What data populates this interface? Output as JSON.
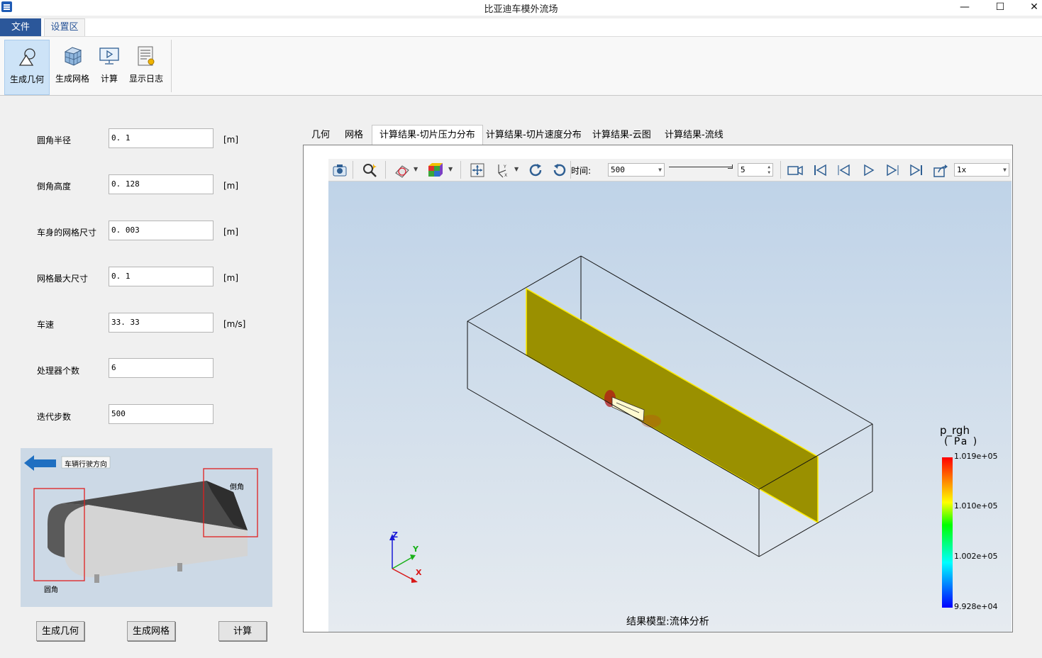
{
  "window": {
    "title": "比亚迪车模外流场",
    "minimize": "—",
    "maximize": "☐",
    "close": "✕"
  },
  "menu": {
    "file": "文件",
    "settings": "设置区"
  },
  "ribbon": [
    {
      "label": "生成几何",
      "icon": "geometry-shapes-icon",
      "active": true
    },
    {
      "label": "生成网格",
      "icon": "mesh-cube-icon"
    },
    {
      "label": "计算",
      "icon": "compute-monitor-icon"
    },
    {
      "label": "显示日志",
      "icon": "log-document-icon"
    }
  ],
  "form": [
    {
      "label": "圆角半径",
      "value": "0. 1",
      "unit": "[m]"
    },
    {
      "label": "倒角高度",
      "value": "0. 128",
      "unit": "[m]"
    },
    {
      "label": "车身的网格尺寸",
      "value": "0. 003",
      "unit": "[m]"
    },
    {
      "label": "网格最大尺寸",
      "value": "0. 1",
      "unit": "[m]"
    },
    {
      "label": "车速",
      "value": "33. 33",
      "unit": "[m/s]"
    },
    {
      "label": "处理器个数",
      "value": "6",
      "unit": ""
    },
    {
      "label": "迭代步数",
      "value": "500",
      "unit": ""
    }
  ],
  "diagram": {
    "direction_label": "车辆行驶方向",
    "chamfer_label": "倒角",
    "fillet_label": "圆角"
  },
  "buttons": {
    "geometry": "生成几何",
    "mesh": "生成网格",
    "compute": "计算"
  },
  "tabs": [
    "几何",
    "网格",
    "计算结果-切片压力分布",
    "计算结果-切片速度分布",
    "计算结果-云图",
    "计算结果-流线"
  ],
  "active_tab": 2,
  "toolbar": {
    "time_label": "时间:",
    "time_value": "500",
    "step_value": "5",
    "speed_value": "1x"
  },
  "legend": {
    "title": "p_rgh",
    "unit": "( Pa )",
    "ticks": [
      "1.019e+05",
      "1.010e+05",
      "1.002e+05",
      "9.928e+04"
    ]
  },
  "axes": {
    "z": "Z",
    "y": "Y",
    "x": "X"
  },
  "caption": "结果模型:流体分析",
  "colors": {
    "accent": "#2b579a",
    "slice": "#9a9000",
    "slice_edge": "#ffee00"
  }
}
